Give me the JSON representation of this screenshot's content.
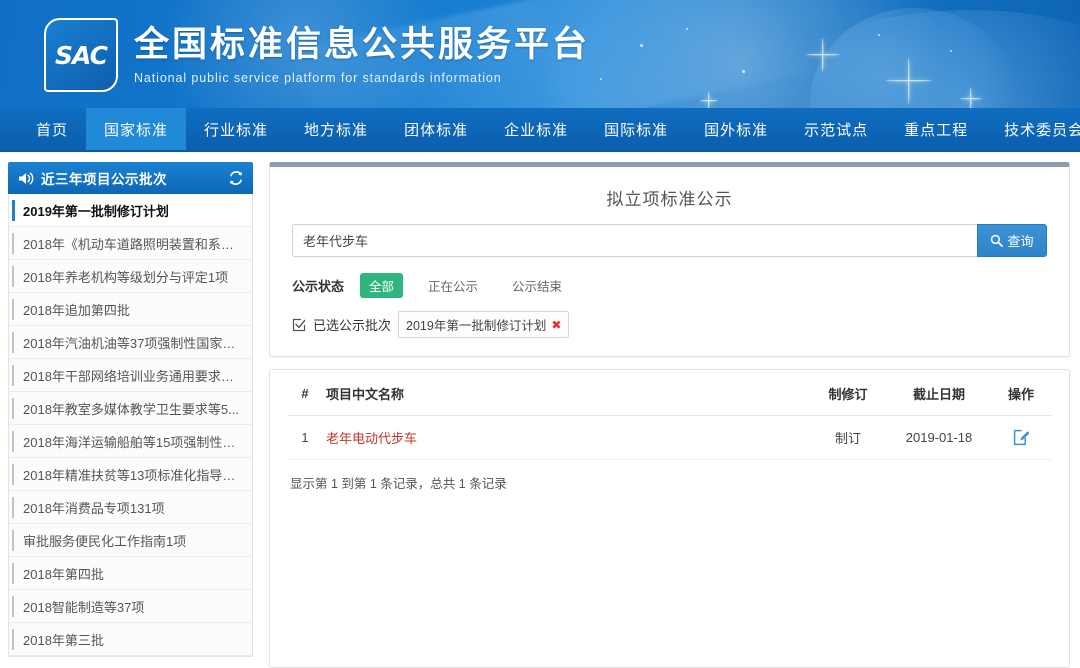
{
  "header": {
    "logo_text": "SAC",
    "title_cn": "全国标准信息公共服务平台",
    "title_en": "National public service platform  for standards information"
  },
  "nav": {
    "items": [
      {
        "label": "首页",
        "active": false
      },
      {
        "label": "国家标准",
        "active": true
      },
      {
        "label": "行业标准",
        "active": false
      },
      {
        "label": "地方标准",
        "active": false
      },
      {
        "label": "团体标准",
        "active": false
      },
      {
        "label": "企业标准",
        "active": false
      },
      {
        "label": "国际标准",
        "active": false
      },
      {
        "label": "国外标准",
        "active": false
      },
      {
        "label": "示范试点",
        "active": false
      },
      {
        "label": "重点工程",
        "active": false
      },
      {
        "label": "技术委员会",
        "active": false
      }
    ]
  },
  "sidebar": {
    "title": "近三年项目公示批次",
    "speaker_icon": "speaker-icon",
    "refresh_icon": "refresh-icon",
    "items": [
      {
        "label": "2019年第一批制修订计划",
        "active": true
      },
      {
        "label": "2018年《机动车道路照明装置和系统...",
        "active": false
      },
      {
        "label": "2018年养老机构等级划分与评定1项",
        "active": false
      },
      {
        "label": "2018年追加第四批",
        "active": false
      },
      {
        "label": "2018年汽油机油等37项强制性国家标...",
        "active": false
      },
      {
        "label": "2018年干部网络培训业务通用要求等...",
        "active": false
      },
      {
        "label": "2018年教室多媒体教学卫生要求等5...",
        "active": false
      },
      {
        "label": "2018年海洋运输船舶等15项强制性国...",
        "active": false
      },
      {
        "label": "2018年精准扶贫等13项标准化指导性...",
        "active": false
      },
      {
        "label": "2018年消费品专项131项",
        "active": false
      },
      {
        "label": "审批服务便民化工作指南1项",
        "active": false
      },
      {
        "label": "2018年第四批",
        "active": false
      },
      {
        "label": "2018智能制造等37项",
        "active": false
      },
      {
        "label": "2018年第三批",
        "active": false
      }
    ]
  },
  "main": {
    "panel_title": "拟立项标准公示",
    "search": {
      "value": "老年代步车",
      "placeholder": "",
      "button_label": "查询",
      "button_icon": "search-icon"
    },
    "status_filter": {
      "label": "公示状态",
      "options": [
        {
          "label": "全部",
          "active": true
        },
        {
          "label": "正在公示",
          "active": false
        },
        {
          "label": "公示结束",
          "active": false
        }
      ]
    },
    "batch_filter": {
      "icon": "check-square-icon",
      "label": "已选公示批次",
      "tag": "2019年第一批制修订计划",
      "tag_close": "✖"
    },
    "table": {
      "columns": [
        "#",
        "项目中文名称",
        "制修订",
        "截止日期",
        "操作"
      ],
      "rows": [
        {
          "num": "1",
          "name": "老年电动代步车",
          "revision": "制订",
          "deadline": "2019-01-18",
          "action_icon": "edit-document-icon"
        }
      ],
      "footer": "显示第 1 到第 1 条记录，总共 1 条记录"
    }
  },
  "colors": {
    "brand_blue": "#1478cc",
    "nav_active": "#2089d8",
    "chip_green": "#2fb67e",
    "link_red": "#c0392b",
    "search_btn": "#3d92d4"
  }
}
